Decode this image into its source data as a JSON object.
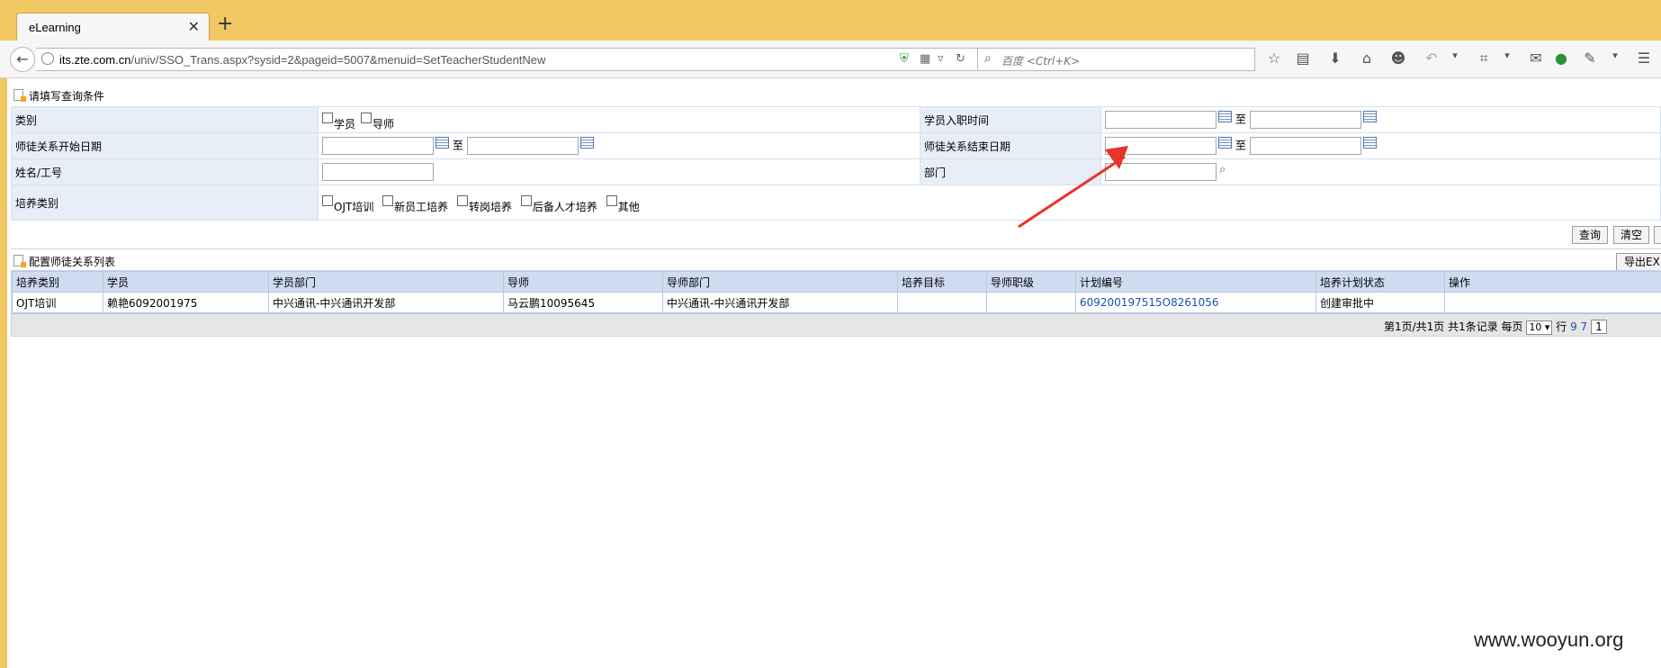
{
  "browser": {
    "tab_title": "eLearning",
    "tab_close": "✕",
    "new_tab": "+",
    "url_domain": "its.zte.com.cn",
    "url_path": "/univ/SSO_Trans.aspx?sysid=2&pageid=5007&menuid=SetTeacherStudentNew",
    "search_placeholder": "百度 <Ctrl+K>"
  },
  "query_panel": {
    "title": "请填写查询条件",
    "row1": {
      "label_category": "类别",
      "opt_student": "学员",
      "opt_mentor": "导师",
      "label_join_time": "学员入职时间",
      "to": "至"
    },
    "row2": {
      "label_start": "师徒关系开始日期",
      "to": "至",
      "label_end": "师徒关系结束日期",
      "to2": "至"
    },
    "row3": {
      "label_name": "姓名/工号",
      "label_dept": "部门"
    },
    "row4": {
      "label_type": "培养类别",
      "options": [
        "OJT培训",
        "新员工培养",
        "转岗培养",
        "后备人才培养",
        "其他"
      ]
    },
    "buttons": {
      "query": "查询",
      "clear": "清空"
    }
  },
  "list_panel": {
    "title": "配置师徒关系列表",
    "export_label": "导出EX",
    "columns": [
      "培养类别",
      "学员",
      "学员部门",
      "导师",
      "导师部门",
      "培养目标",
      "导师职级",
      "计划编号",
      "培养计划状态",
      "操作"
    ],
    "rows": [
      [
        "OJT培训",
        "赖艳6092001975",
        "中兴通讯-中兴通讯开发部",
        "马云鹏10095645",
        "中兴通讯-中兴通讯开发部",
        "",
        "",
        "609200197515O8261056",
        "创建审批中",
        ""
      ]
    ],
    "pager": {
      "summary": "第1页/共1页  共1条记录  每页",
      "per_page": "10",
      "suffix": "行",
      "nav": "9 7",
      "page": "1"
    }
  },
  "watermark": "www.wooyun.org",
  "colors": {
    "tab_strip": "#f0c762",
    "label_bg": "#e8eef8",
    "header_bg": "#cfdcf0",
    "arrow": "#e8332a"
  }
}
